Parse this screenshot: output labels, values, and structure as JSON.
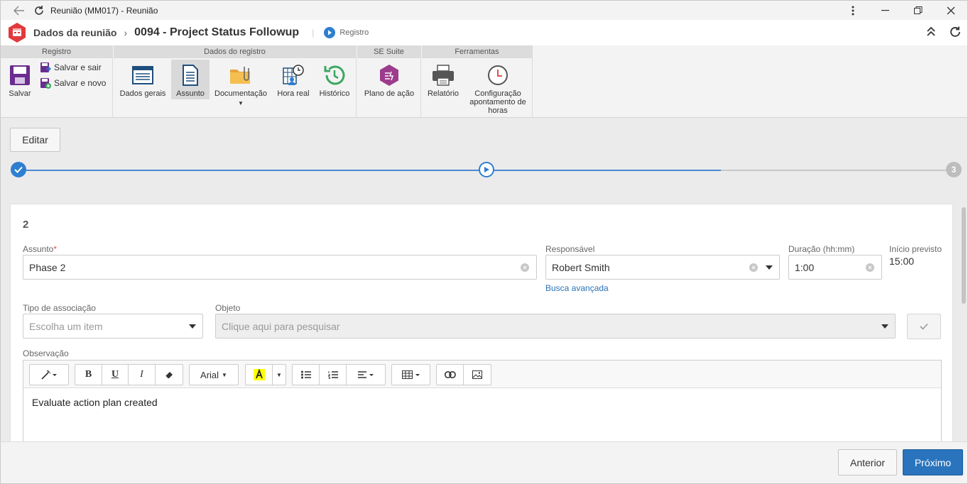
{
  "window": {
    "title": "Reunião (MM017) - Reunião"
  },
  "header": {
    "crumb_root": "Dados da reunião",
    "crumb_record": "0094 - Project Status Followup",
    "separator": "|",
    "status_label": "Registro"
  },
  "ribbon": {
    "groups": [
      {
        "title": "Registro"
      },
      {
        "title": "Dados do registro"
      },
      {
        "title": "SE Suite"
      },
      {
        "title": "Ferramentas"
      }
    ],
    "salvar": "Salvar",
    "salvar_sair": "Salvar e sair",
    "salvar_novo": "Salvar e novo",
    "dados_gerais": "Dados gerais",
    "assunto": "Assunto",
    "documentacao": "Documentação",
    "hora_real": "Hora real",
    "historico": "Histórico",
    "plano_acao": "Plano de ação",
    "relatorio": "Relatório",
    "config_line1": "Configuração",
    "config_line2": "apontamento de",
    "config_line3": "horas"
  },
  "content": {
    "edit_button": "Editar",
    "stepper": {
      "current_step": 2,
      "total_steps": 3,
      "last_step_label": "3"
    },
    "card": {
      "number": "2",
      "assunto_label": "Assunto",
      "assunto_required": "*",
      "assunto_value": "Phase 2",
      "responsavel_label": "Responsável",
      "responsavel_value": "Robert Smith",
      "busca_avancada": "Busca avançada",
      "duracao_label": "Duração (hh:mm)",
      "duracao_value": "1:00",
      "inicio_label": "Início previsto",
      "inicio_value": "15:00",
      "tipo_label": "Tipo de associação",
      "tipo_placeholder": "Escolha um item",
      "objeto_label": "Objeto",
      "objeto_placeholder": "Clique aqui para pesquisar",
      "observacao_label": "Observação",
      "font_name": "Arial",
      "bold": "B",
      "underline": "U",
      "italic": "I",
      "observacao_text": "Evaluate action plan created"
    }
  },
  "footer": {
    "anterior": "Anterior",
    "proximo": "Próximo"
  },
  "colors": {
    "accent": "#2a74bd",
    "step_done": "#2f7fd0",
    "pending": "#bdbdbd",
    "logo": "#e2393c"
  }
}
